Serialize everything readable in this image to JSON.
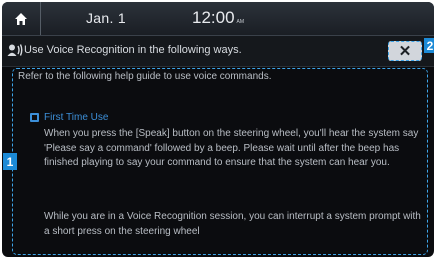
{
  "status_bar": {
    "date": "Jan. 1",
    "time": "12:00",
    "ampm": "AM"
  },
  "title_bar": {
    "title": "Use Voice Recognition in the following ways.",
    "close_label": "✕"
  },
  "callouts": {
    "one": "1",
    "two": "2"
  },
  "help": {
    "intro": "Refer to the following help guide to use voice commands.",
    "section_title": "First Time Use",
    "paragraph_1": "When you press the [Speak] button on the steering wheel, you'll hear the system say 'Please say a command' followed by a beep. Please wait until after the beep has finished playing to say your command to ensure that the system can hear you.",
    "paragraph_2": "While you are in a Voice Recognition session, you can interrupt a system prompt with a short press on the steering wheel"
  },
  "colors": {
    "accent": "#3c8fd8",
    "callout": "#1c8ad6",
    "background": "#0b0c0f"
  }
}
